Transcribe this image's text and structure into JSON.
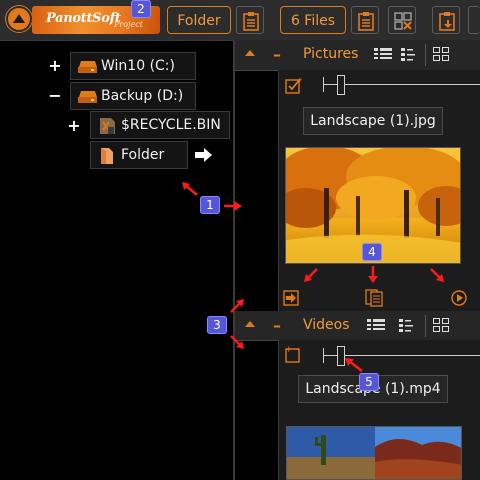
{
  "toolbar": {
    "logo_text": "PanottSoft",
    "logo_sub": "Project",
    "folder_button": "Folder",
    "files_button": "6 Files"
  },
  "tree": {
    "items": [
      {
        "expander": "+",
        "label": "Win10 (C:)",
        "icon": "drive-icon"
      },
      {
        "expander": "−",
        "label": "Backup (D:)",
        "icon": "drive-icon"
      },
      {
        "expander": "+",
        "label": "$RECYCLE.BIN",
        "icon": "recycle-bin-icon"
      },
      {
        "expander": "",
        "label": "Folder",
        "icon": "folder-icon"
      }
    ]
  },
  "panels": {
    "pictures": {
      "title": "Pictures",
      "filename": "Landscape (1).jpg"
    },
    "videos": {
      "title": "Videos",
      "filename": "Landscape (1).mp4"
    }
  },
  "badges": [
    "1",
    "2",
    "3",
    "4",
    "5"
  ],
  "colors": {
    "accent": "#e07a1a",
    "badge": "#5656d8",
    "arrow": "#ff1a1a",
    "background": "#000000",
    "toolbar": "#2c2c2c"
  }
}
